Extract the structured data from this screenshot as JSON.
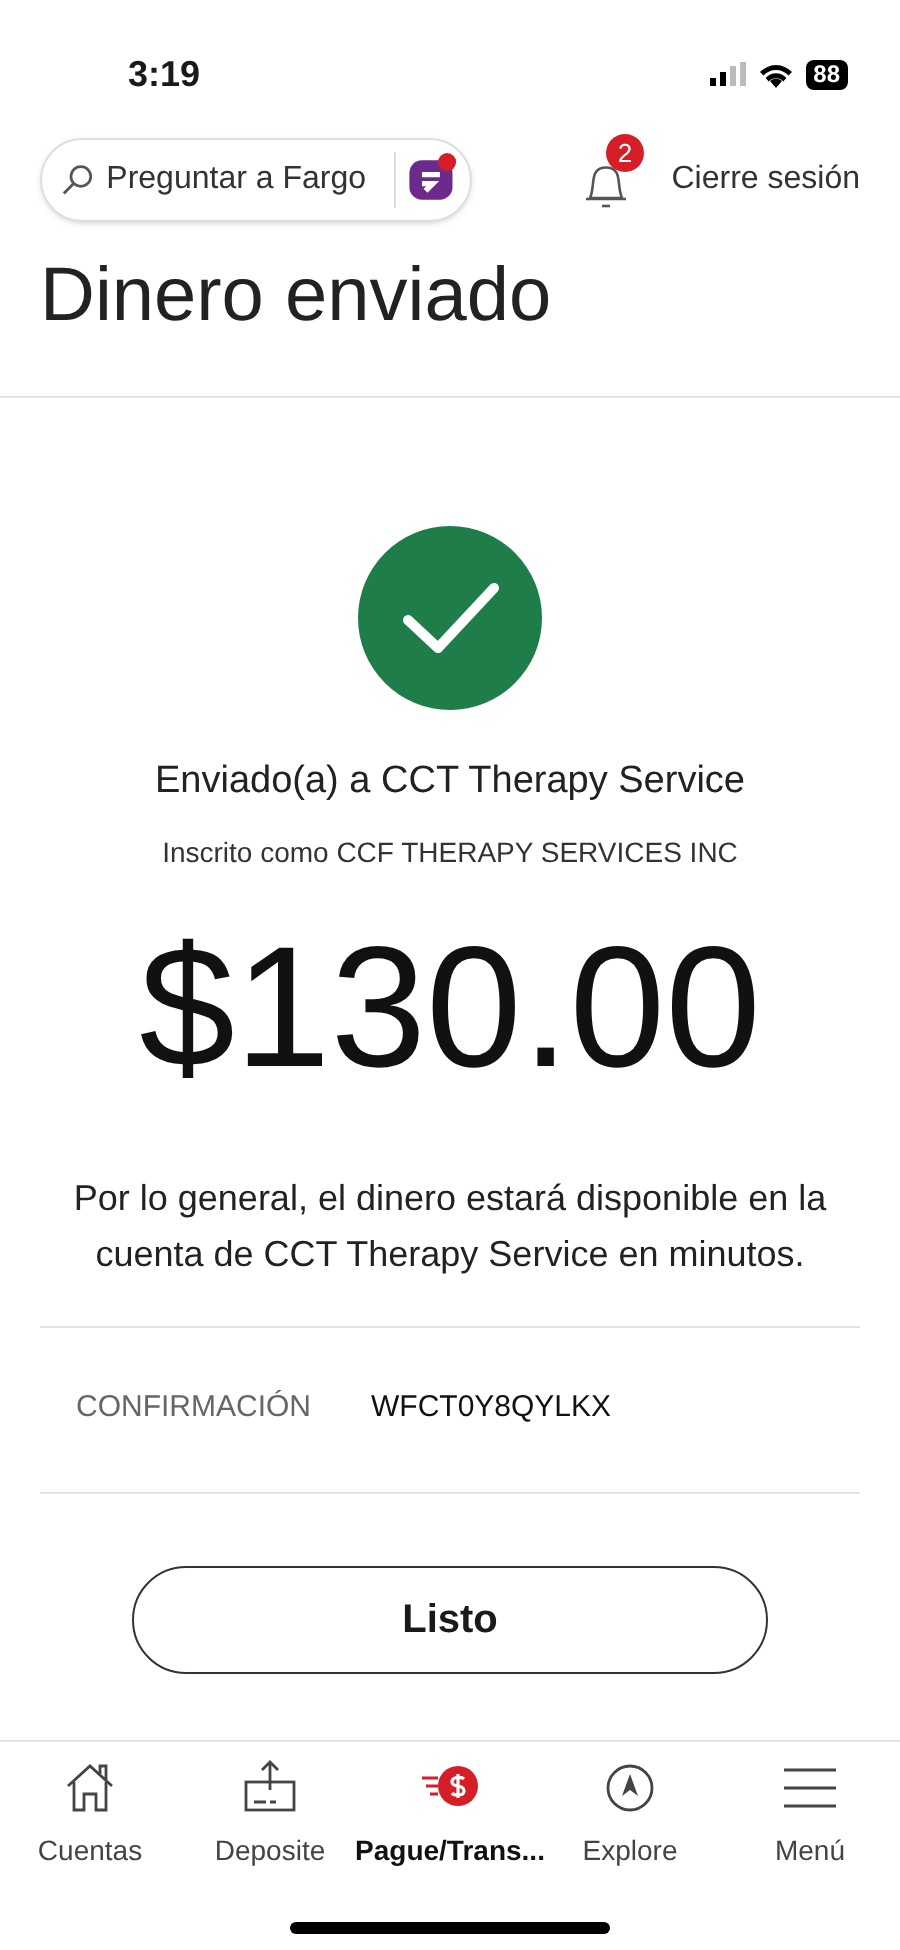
{
  "status_bar": {
    "time": "3:19",
    "battery": "88"
  },
  "header": {
    "search": {
      "placeholder": "Preguntar a Fargo"
    },
    "notifications": {
      "count": "2"
    },
    "logout": "Cierre sesión"
  },
  "title": "Dinero enviado",
  "result": {
    "heading": "Enviado(a) a CCT Therapy Service",
    "subheading": "Inscrito como CCF THERAPY SERVICES INC",
    "amount": "$130.00",
    "message": "Por lo general, el dinero estará disponible en la cuenta de CCT Therapy Service en minutos."
  },
  "confirmation": {
    "label": "CONFIRMACIÓN",
    "value": "WFCT0Y8QYLKX"
  },
  "done_button": "Listo",
  "nav": [
    {
      "kind": "home",
      "label": "Cuentas",
      "selected": false
    },
    {
      "kind": "deposit",
      "label": "Deposite",
      "selected": false
    },
    {
      "kind": "pay",
      "label": "Pague/Trans...",
      "selected": true
    },
    {
      "kind": "explore",
      "label": "Explore",
      "selected": false
    },
    {
      "kind": "menu",
      "label": "Menú",
      "selected": false
    }
  ]
}
